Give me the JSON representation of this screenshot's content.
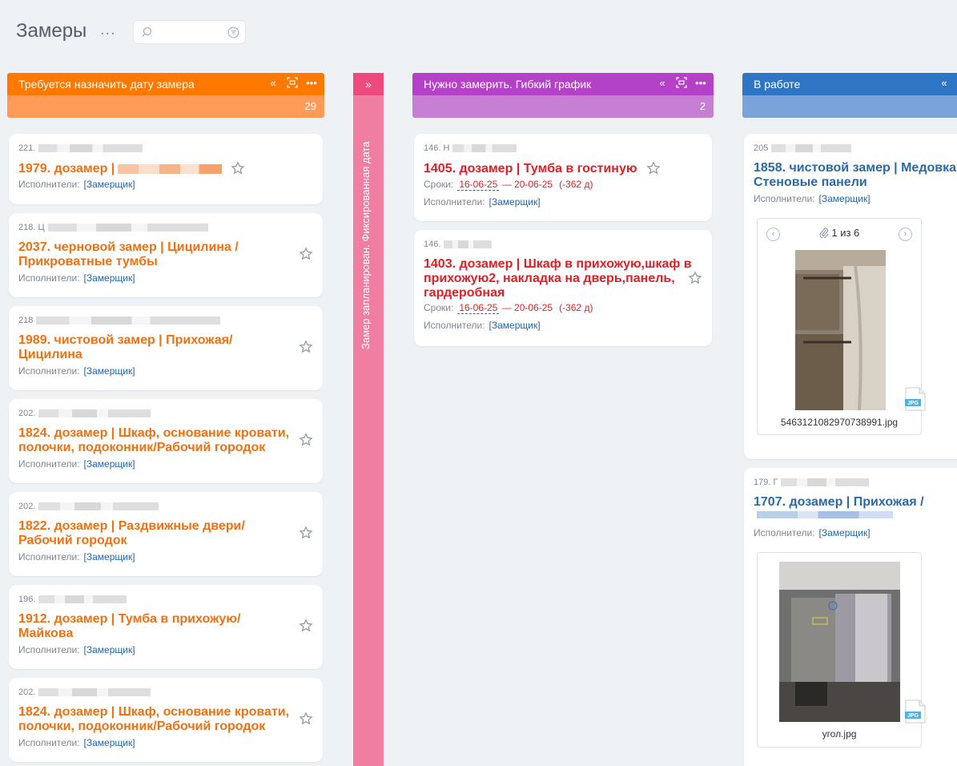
{
  "header": {
    "title": "Замеры",
    "more": "...",
    "search": {
      "value": "",
      "placeholder": ""
    }
  },
  "colors": {
    "orange": "#ff7800",
    "orange_light": "#ff9a57",
    "pink": "#ee4a7e",
    "purple": "#b441c8",
    "purple_light": "#c77fd6",
    "blue": "#2f75c6",
    "blue_light": "#7aa3da"
  },
  "columns": [
    {
      "title": "Требуется назначить дату замера",
      "count": "29",
      "cards": [
        {
          "pre": "221.",
          "title": "1979. дозамер |",
          "executors_label": "Исполнители:",
          "executor": "[Замерщик]"
        },
        {
          "pre": "218. Ц",
          "title": "2037. черновой замер | Цицилина / Прикроватные тумбы",
          "executors_label": "Исполнители:",
          "executor": "[Замерщик]"
        },
        {
          "pre": "218",
          "title": "1989. чистовой замер | Прихожая/ Цицилина",
          "executors_label": "Исполнители:",
          "executor": "[Замерщик]"
        },
        {
          "pre": "202.",
          "title": "1824. дозамер | Шкаф, основание кровати, полочки, подоконник/Рабочий городок",
          "executors_label": "Исполнители:",
          "executor": "[Замерщик]"
        },
        {
          "pre": "202.",
          "title": "1822. дозамер | Раздвижные двери/ Рабочий городок",
          "executors_label": "Исполнители:",
          "executor": "[Замерщик]"
        },
        {
          "pre": "196.",
          "title": "1912. дозамер | Тумба в прихожую/ Майкова",
          "executors_label": "Исполнители:",
          "executor": "[Замерщик]"
        },
        {
          "pre": "202.",
          "title": "1824. дозамер | Шкаф, основание кровати, полочки, подоконник/Рабочий городок",
          "executors_label": "Исполнители:",
          "executor": "[Замерщик]"
        }
      ]
    },
    {
      "title": "Замер запланирован. Фиксированная дата",
      "expand": "»"
    },
    {
      "title": "Нужно замерить. Гибкий график",
      "count": "2",
      "cards": [
        {
          "pre": "146. Н",
          "title": "1405. дозамер | Тумба в гостиную",
          "deadline_label": "Сроки:",
          "date_from": "16-06-25",
          "dash": "—",
          "date_to": "20-06-25",
          "overdue": "(-362 д)",
          "executors_label": "Исполнители:",
          "executor": "[Замерщик]"
        },
        {
          "pre": "146.",
          "title": "1403. дозамер | Шкаф в прихожую,шкаф в прихожую2, накладка на дверь,панель, гардеробная",
          "deadline_label": "Сроки:",
          "date_from": "16-06-25",
          "dash": "—",
          "date_to": "20-06-25",
          "overdue": "(-362 д)",
          "executors_label": "Исполнители:",
          "executor": "[Замерщик]"
        }
      ]
    },
    {
      "title": "В работе",
      "cards": [
        {
          "pre": "205",
          "title": "1858. чистовой замер | Медовка Стеновые панели",
          "executors_label": "Исполнители:",
          "executor": "[Замерщик]",
          "pager": "1 из 6",
          "file": "5463121082970738991.jpg",
          "file_type": "JPG"
        },
        {
          "pre": "179. Г",
          "title": "1707. дозамер | Прихожая /",
          "executors_label": "Исполнители:",
          "executor": "[Замерщик]",
          "file": "угол.jpg",
          "file_type": "JPG"
        }
      ]
    }
  ],
  "icons": {
    "collapse": "chevrons-left-icon",
    "focus": "focus-icon",
    "more": "more-icon",
    "star": "star-icon",
    "search": "search-icon",
    "filter": "filter-icon",
    "attach": "paperclip-icon"
  }
}
